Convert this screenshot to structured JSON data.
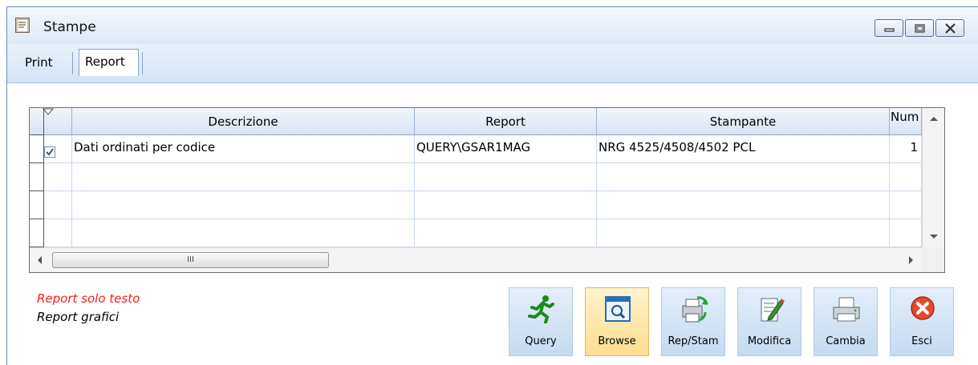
{
  "window": {
    "title": "Stampe",
    "app_icon": "document-icon",
    "controls": [
      "minimize-icon",
      "restore-icon",
      "close-icon"
    ]
  },
  "tabs": [
    {
      "label": "Print",
      "active": false
    },
    {
      "label": "Report",
      "active": true
    }
  ],
  "grid": {
    "columns": [
      "Descrizione",
      "Report",
      "Stampante",
      "Num"
    ],
    "rows": [
      {
        "checked": true,
        "descrizione": "Dati ordinati per codice",
        "report": "QUERY\\GSAR1MAG",
        "stampante": "NRG 4525/4508/4502 PCL",
        "num": "1"
      }
    ],
    "scroll_thumb_glyph": "III"
  },
  "legend": {
    "text_only": "Report solo testo",
    "graphic": "Report grafici",
    "text_only_color": "#ff1a1a"
  },
  "toolbar": [
    {
      "label": "Query",
      "icon": "running-man-icon"
    },
    {
      "label": "Browse",
      "icon": "browse-window-icon",
      "active": true
    },
    {
      "label": "Rep/Stam",
      "icon": "printer-refresh-icon"
    },
    {
      "label": "Modifica",
      "icon": "edit-document-icon"
    },
    {
      "label": "Cambia",
      "icon": "printer-icon"
    },
    {
      "label": "Esci",
      "icon": "close-circle-icon"
    }
  ]
}
